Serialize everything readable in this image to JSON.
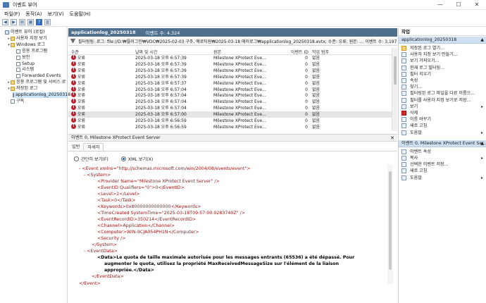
{
  "window": {
    "title": "이벤트 뷰어",
    "controls": [
      "—",
      "☐",
      "✕"
    ]
  },
  "menu": [
    "파일(F)",
    "동작(A)",
    "보기(V)",
    "도움말(H)"
  ],
  "tree": {
    "items": [
      {
        "label": "이벤트 뷰어 (로컬)",
        "level": 0,
        "twisty": "",
        "icon": "mag"
      },
      {
        "label": "사용자 지정 보기",
        "level": 1,
        "twisty": ">",
        "icon": "folder"
      },
      {
        "label": "Windows 로그",
        "level": 1,
        "twisty": "v",
        "icon": "folder"
      },
      {
        "label": "응용 프로그램",
        "level": 2,
        "twisty": "",
        "icon": "log"
      },
      {
        "label": "보안",
        "level": 2,
        "twisty": "",
        "icon": "log"
      },
      {
        "label": "Setup",
        "level": 2,
        "twisty": "",
        "icon": "log"
      },
      {
        "label": "시스템",
        "level": 2,
        "twisty": "",
        "icon": "log"
      },
      {
        "label": "Forwarded Events",
        "level": 2,
        "twisty": "",
        "icon": "log"
      },
      {
        "label": "응용 프로그램 및 서비스 로",
        "level": 1,
        "twisty": ">",
        "icon": "folder"
      },
      {
        "label": "저장된 로그",
        "level": 1,
        "twisty": "v",
        "icon": "folder"
      },
      {
        "label": "applicationlog_20250318",
        "level": 2,
        "twisty": "",
        "icon": "log",
        "selected": true
      },
      {
        "label": "구독",
        "level": 1,
        "twisty": "",
        "icon": "log"
      }
    ]
  },
  "logtab": {
    "name": "applicationlog_20250318",
    "count": "이벤트 수: 4,324"
  },
  "filter": {
    "text": "필터링됨: 로그: file://D:₩플러그인₩VDC₩2025-02-03 구주, 예로티원₩2025-03-18 에러로그₩applicationlog_20250318.evtx; 수준: 오류; 원본: ... 이벤트 수: 3,197"
  },
  "columns": [
    "수준",
    "날짜 및 시간",
    "원본",
    "이벤트 ID",
    "작업 범주"
  ],
  "events": [
    {
      "level": "오류",
      "datetime": "2025-03-18 오후 6:57:39",
      "source": "Milestone XProtect Eve...",
      "id": "0",
      "category": "없음"
    },
    {
      "level": "오류",
      "datetime": "2025-03-18 오후 6:57:39",
      "source": "Milestone XProtect Eve...",
      "id": "0",
      "category": "없음"
    },
    {
      "level": "오류",
      "datetime": "2025-03-18 오후 6:57:39",
      "source": "Milestone XProtect Eve...",
      "id": "0",
      "category": "없음"
    },
    {
      "level": "오류",
      "datetime": "2025-03-18 오후 6:57:39",
      "source": "Milestone XProtect Eve...",
      "id": "0",
      "category": "없음"
    },
    {
      "level": "오류",
      "datetime": "2025-03-18 오후 6:57:37",
      "source": "Milestone XProtect Eve...",
      "id": "0",
      "category": "없음"
    },
    {
      "level": "오류",
      "datetime": "2025-03-18 오후 6:57:04",
      "source": "Milestone XProtect Eve...",
      "id": "0",
      "category": "없음"
    },
    {
      "level": "오류",
      "datetime": "2025-03-18 오후 6:57:04",
      "source": "Milestone XProtect Eve...",
      "id": "0",
      "category": "없음"
    },
    {
      "level": "오류",
      "datetime": "2025-03-18 오후 6:57:04",
      "source": "Milestone XProtect Eve...",
      "id": "0",
      "category": "없음"
    },
    {
      "level": "오류",
      "datetime": "2025-03-18 오후 6:57:04",
      "source": "Milestone XProtect Eve...",
      "id": "0",
      "category": "없음"
    },
    {
      "level": "오류",
      "datetime": "2025-03-18 오후 6:57:00",
      "source": "Milestone XProtect Eve...",
      "id": "0",
      "category": "없음",
      "selected": true
    },
    {
      "level": "오류",
      "datetime": "2025-03-18 오후 6:56:59",
      "source": "Milestone XProtect Eve...",
      "id": "0",
      "category": "없음"
    },
    {
      "level": "오류",
      "datetime": "2025-03-18 오후 6:56:59",
      "source": "Milestone XProtect Eve...",
      "id": "0",
      "category": "없음"
    }
  ],
  "detail": {
    "header": "이벤트 0, Milestone XProtect Event Server",
    "tabs": [
      "일반",
      "자세히"
    ],
    "radio_friendly": "간단히 보기(F)",
    "radio_xml": "XML 보기(X)"
  },
  "xml": {
    "event_open": "<Event xmlns=\"http://schemas.microsoft.com/win/2004/08/events/event\">",
    "system_open": "<System>",
    "provider": "<Provider Name=\"Milestone XProtect Event Server\" />",
    "eventid": "<EventID Qualifiers=\"0\">0</EventID>",
    "level": "<Level>2</Level>",
    "task": "<Task>0</Task>",
    "keywords": "<Keywords>0x80000000000000</Keywords>",
    "timecreated": "<TimeCreated SystemTime=\"2025-03-18T09:57:00.0283740Z\" />",
    "recordid": "<EventRecordID>350214</EventRecordID>",
    "channel": "<Channel>Application</Channel>",
    "computer": "<Computer>WIN-9CJA054PH1N</Computer>",
    "security": "<Security />",
    "system_close": "</System>",
    "eventdata_open": "<EventData>",
    "data_line1": "<Data>Le quota de taille maximale autorisée pour les messages entrants (65536) a été dépassé. Pour",
    "data_line2": "augmenter le quota, utilisez la propriété MaxReceivedMessageSize sur l'élément de la liaison",
    "data_line3": "appropriée.</Data>",
    "eventdata_close": "</EventData>",
    "event_close": "</Event>"
  },
  "actions": {
    "title": "작업",
    "section1": "applicationlog_20250318",
    "items1": [
      {
        "label": "저장된 로그 열기...",
        "icon": "yel",
        "arrow": ""
      },
      {
        "label": "사용자 지정 보기 만들기...",
        "icon": "",
        "arrow": ""
      },
      {
        "label": "보기 가져오기...",
        "icon": "",
        "arrow": ""
      },
      {
        "label": "현재 로그 필터링...",
        "icon": "",
        "arrow": ""
      },
      {
        "label": "필터 지우기",
        "icon": "",
        "arrow": ""
      },
      {
        "label": "속성",
        "icon": "",
        "arrow": ""
      },
      {
        "label": "찾기...",
        "icon": "",
        "arrow": ""
      },
      {
        "label": "필터링된 로그 파일을 다른 이름으...",
        "icon": "",
        "arrow": ""
      },
      {
        "label": "필터를 사용자 지정 보기로 저장...",
        "icon": "",
        "arrow": ""
      },
      {
        "label": "보기",
        "icon": "",
        "arrow": "▸"
      },
      {
        "label": "삭제",
        "icon": "red",
        "arrow": ""
      },
      {
        "label": "이름 바꾸기",
        "icon": "",
        "arrow": ""
      },
      {
        "label": "새로 고침",
        "icon": "",
        "arrow": ""
      },
      {
        "label": "도움말",
        "icon": "",
        "arrow": "▸"
      }
    ],
    "section2": "이벤트 0, Milestone XProtect Event Ser...",
    "items2": [
      {
        "label": "이벤트 속성",
        "icon": "",
        "arrow": ""
      },
      {
        "label": "복사",
        "icon": "",
        "arrow": "▸"
      },
      {
        "label": "선택한 이벤트 저장...",
        "icon": "",
        "arrow": ""
      },
      {
        "label": "새로 고침",
        "icon": "",
        "arrow": ""
      },
      {
        "label": "도움말",
        "icon": "",
        "arrow": "▸"
      }
    ]
  }
}
